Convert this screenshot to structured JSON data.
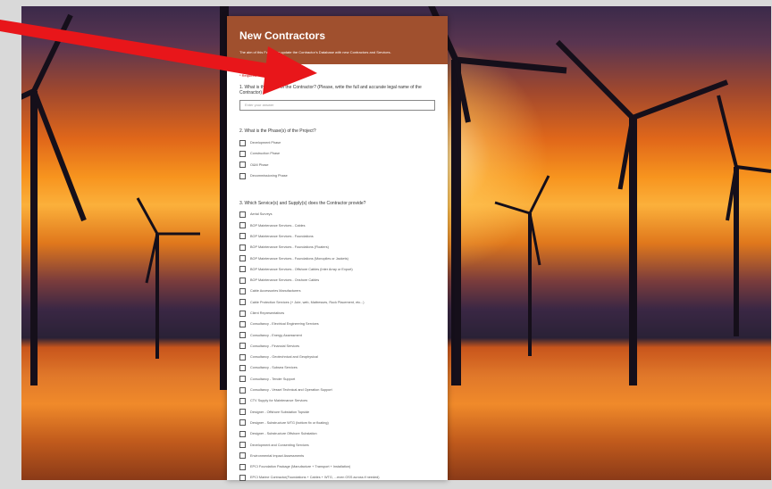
{
  "form": {
    "title": "New Contractors",
    "description": "The aim of this Form is to update the Contractor's Database with new Contractors and Services.",
    "required_note": "* Required",
    "q1": "1. What is the name of the Contractor? (Please, write the full and accurate legal name of the Contractor) *",
    "q1_placeholder": "Enter your answer",
    "q2": "2. What is the Phase(s) of the Project?",
    "q2_options": [
      "Development Phase",
      "Construction Phase",
      "O&M Phase",
      "Decommissioning Phase"
    ],
    "q3": "3. Which Service(s) and Supply(s) does the Contractor provide?",
    "q3_options": [
      "Aerial Surveys",
      "BOP Maintenance Services - Cables",
      "BOP Maintenance Services - Foundations",
      "BOP Maintenance Services - Foundations (Floaters)",
      "BOP Maintenance Services - Foundations (Monopiles or Jackets)",
      "BOP Maintenance Services - Offshore Cables (Inter Array or Export)",
      "BOP Maintenance Services - Onshore Cables",
      "Cable Accessories Manufacturers",
      "Cable Protection Services (+ Jute, web, Mattresses, Rock Placement, etc...)",
      "Client Representatives",
      "Consultancy - Electrical Engineering Services",
      "Consultancy - Energy Assessment",
      "Consultancy - Financial Services",
      "Consultancy - Geotechnical and Geophysical",
      "Consultancy - Subsea Services",
      "Consultancy - Tender Support",
      "Consultancy - Vessel Technical and Operation Support",
      "CTV Supply for Maintenance Services",
      "Designer - Offshore Substation Topside",
      "Designer - Substructure WTG (bottom fix or floating)",
      "Designer - Substructure Offshore Substation",
      "Development and Consenting Services",
      "Environmental Impact Assessments",
      "EPCI Foundation Package (Manufacture + Transport + Installation)",
      "EPCI Marine Contractor(Foundations + Cables + WTG, ...even OSS across if needed)"
    ]
  }
}
